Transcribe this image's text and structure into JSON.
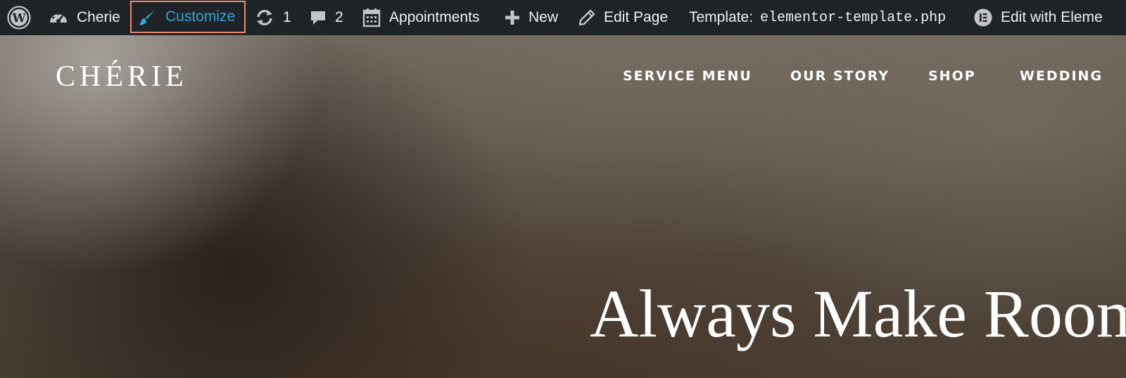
{
  "admin_bar": {
    "site_name": "Cherie",
    "customize_label": "Customize",
    "updates_count": "1",
    "comments_count": "2",
    "appointments_label": "Appointments",
    "new_label": "New",
    "edit_page_label": "Edit Page",
    "template_label": "Template:",
    "template_file": "elementor-template.php",
    "edit_with_label": "Edit with Eleme",
    "highlight_color": "#f08a6c",
    "active_color": "#36a3d5"
  },
  "site": {
    "brand": "CHÉRIE",
    "nav": [
      "SERVICE MENU",
      "OUR STORY",
      "SHOP",
      "WEDDING"
    ],
    "headline": "Always Make Room"
  }
}
